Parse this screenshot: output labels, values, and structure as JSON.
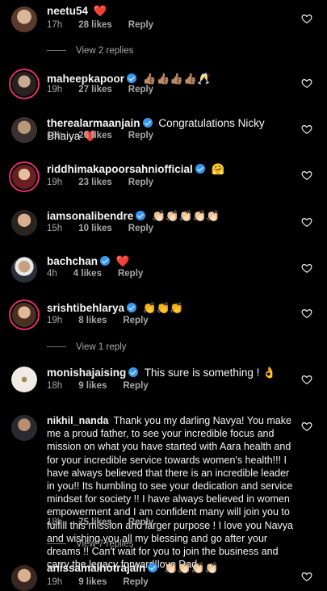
{
  "comments": [
    {
      "username": "neetu54",
      "verified": false,
      "text": "❤️",
      "time": "17h",
      "likes": "28 likes",
      "reply": "Reply",
      "avatar_color": "#b48a6a",
      "ring": false
    },
    {
      "username": "maheepkapoor",
      "verified": true,
      "text": "👍🏽👍🏽👍🏽👍🏽🥂",
      "time": "19h",
      "likes": "27 likes",
      "reply": "Reply",
      "avatar_color": "#6e5d55",
      "ring": true
    },
    {
      "username": "therealarmaanjain",
      "verified": true,
      "text": "Congratulations Nicky Bhaiya ❤️",
      "time": "18h",
      "likes": "26 likes",
      "reply": "Reply",
      "avatar_color": "#4a4a4a",
      "ring": false
    },
    {
      "username": "riddhimakapoorsahniofficial",
      "verified": true,
      "text": "🤗",
      "time": "19h",
      "likes": "23 likes",
      "reply": "Reply",
      "avatar_color": "#8a3a3a",
      "ring": true
    },
    {
      "username": "iamsonalibendre",
      "verified": true,
      "text": "👏🏻👏🏻👏🏻👏🏻👏🏻",
      "time": "15h",
      "likes": "10 likes",
      "reply": "Reply",
      "avatar_color": "#a08060",
      "ring": false
    },
    {
      "username": "bachchan",
      "verified": true,
      "text": "❤️",
      "time": "4h",
      "likes": "4 likes",
      "reply": "Reply",
      "avatar_color": "#55606a",
      "ring": false
    },
    {
      "username": "srishtibehlarya",
      "verified": true,
      "text": "👏👏👏",
      "time": "19h",
      "likes": "8 likes",
      "reply": "Reply",
      "avatar_color": "#9a7860",
      "ring": true
    },
    {
      "username": "monishajaising",
      "verified": true,
      "text": "This sure is something ! 👌",
      "time": "18h",
      "likes": "9 likes",
      "reply": "Reply",
      "avatar_color": "#e8e4dc",
      "ring": false
    },
    {
      "username": "nikhil_nanda",
      "verified": false,
      "text": "Thank you my darling Navya! You make me a proud father, to see your incredible focus and mission on what you have started with Aara health and for your incredible service towards women's health!!! I have always believed that there is an incredible leader in you!! Its humbling to see your dedication and service mindset for society !! I have always believed in women empowerment and I am confident many will join you to fulfill this mission and larger purpose ! I love you Navya and wishing you all my blessing and go after your dreams !! Can't wait for you to join the business and carry the legacy forward!love Dad",
      "time": "18h",
      "likes": "75 likes",
      "reply": "Reply",
      "avatar_color": "#5a4a48",
      "ring": false
    },
    {
      "username": "anissamalhotrajain",
      "verified": true,
      "text": "👏🏻👏🏻👏🏻👏🏻",
      "time": "19h",
      "likes": "9 likes",
      "reply": "Reply",
      "avatar_color": "#7a6050",
      "ring": false
    }
  ],
  "view_replies": [
    "View 2 replies",
    "View 1 reply",
    "View 7 replies"
  ],
  "icons": {
    "like": "heart-outline-icon",
    "verified": "verified-badge-icon"
  }
}
